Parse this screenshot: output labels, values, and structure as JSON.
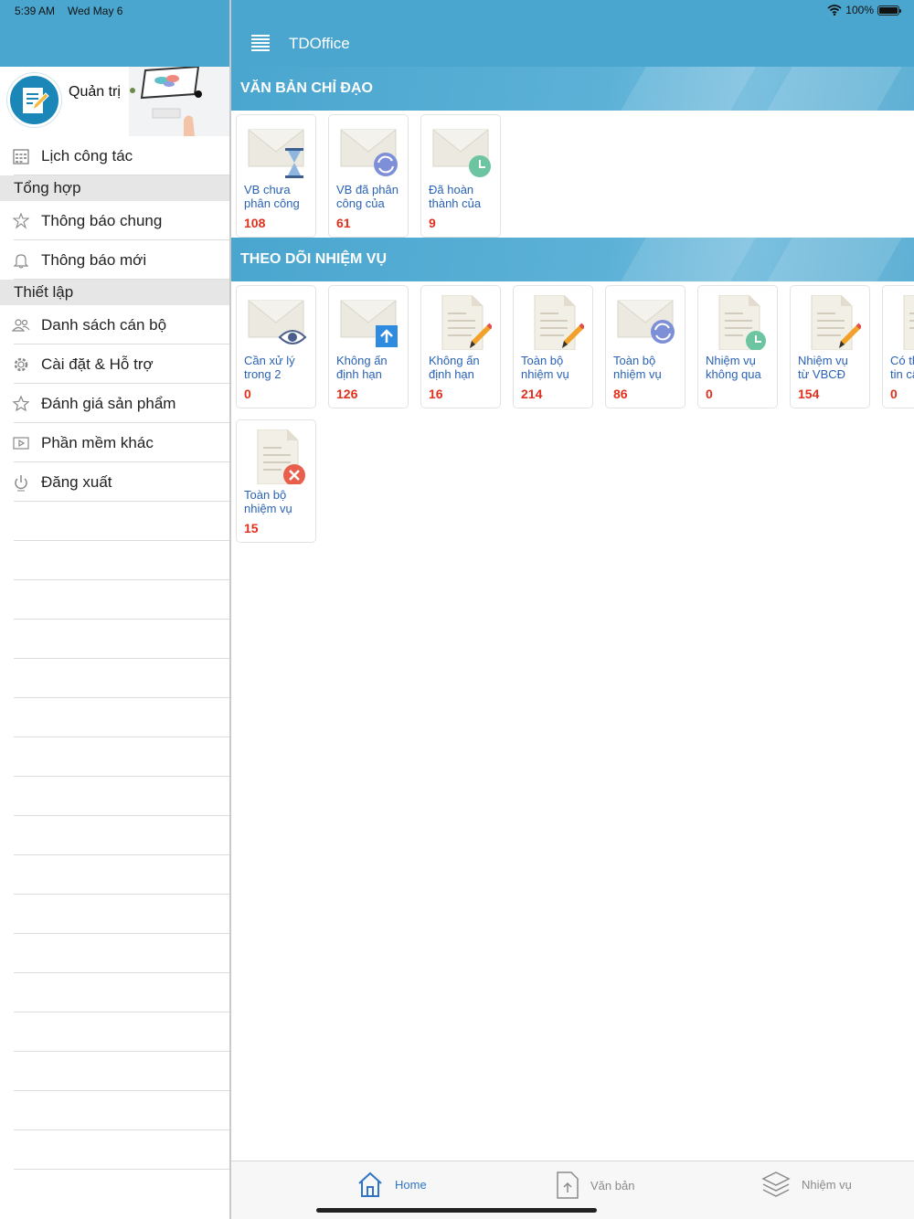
{
  "status_bar": {
    "time": "5:39 AM",
    "date": "Wed May 6",
    "battery": "100%"
  },
  "sidebar": {
    "profile_name": "Quản trị",
    "top_item": {
      "label": "Lịch công tác",
      "icon": "calendar-icon"
    },
    "groups": [
      {
        "title": "Tổng hợp",
        "items": [
          {
            "label": "Thông báo chung",
            "icon": "megaphone-icon"
          },
          {
            "label": "Thông báo mới",
            "icon": "bell-icon"
          }
        ]
      },
      {
        "title": "Thiết lập",
        "items": [
          {
            "label": "Danh sách cán bộ",
            "icon": "users-icon"
          },
          {
            "label": "Cài đặt & Hỗ trợ",
            "icon": "gear-icon"
          },
          {
            "label": "Đánh giá sản phẩm",
            "icon": "star-icon"
          },
          {
            "label": "Phần mềm khác",
            "icon": "play-box-icon"
          },
          {
            "label": "Đăng xuất",
            "icon": "power-icon"
          }
        ]
      }
    ]
  },
  "navbar": {
    "title": "TDOffice"
  },
  "sections": [
    {
      "title": "VĂN BẢN CHỈ ĐẠO",
      "tiles": [
        {
          "line1": "VB chưa",
          "line2": "phân công",
          "count": "108",
          "icon": "envelope-hourglass-icon"
        },
        {
          "line1": "VB đã phân",
          "line2": "công của",
          "count": "61",
          "icon": "envelope-sync-icon"
        },
        {
          "line1": "Đã hoàn",
          "line2": "thành của",
          "count": "9",
          "icon": "envelope-clock-icon"
        }
      ]
    },
    {
      "title": "THEO DÕI NHIỆM VỤ",
      "tiles": [
        {
          "line1": "Cần xử lý",
          "line2": "trong 2",
          "count": "0",
          "icon": "envelope-eye-icon"
        },
        {
          "line1": "Không ấn",
          "line2": "định hạn",
          "count": "126",
          "icon": "envelope-upload-icon"
        },
        {
          "line1": "Không ấn",
          "line2": "định hạn",
          "count": "16",
          "icon": "document-pencil-icon"
        },
        {
          "line1": "Toàn bộ",
          "line2": "nhiệm vụ",
          "count": "214",
          "icon": "document-pencil-icon"
        },
        {
          "line1": "Toàn bộ",
          "line2": "nhiệm vụ",
          "count": "86",
          "icon": "envelope-sync-icon"
        },
        {
          "line1": "Nhiệm vụ",
          "line2": "không qua",
          "count": "0",
          "icon": "document-clock-icon"
        },
        {
          "line1": "Nhiệm vụ",
          "line2": "từ VBCĐ",
          "count": "154",
          "icon": "document-pencil-icon"
        },
        {
          "line1": "Có th",
          "line2": "tin cậ",
          "count": "0",
          "icon": "document-icon"
        },
        {
          "line1": "Toàn bộ",
          "line2": "nhiệm vụ",
          "count": "15",
          "icon": "document-cancel-icon"
        }
      ]
    }
  ],
  "tabbar": [
    {
      "label": "Home",
      "icon": "home-icon",
      "active": true
    },
    {
      "label": "Văn bản",
      "icon": "document-upload-icon",
      "active": false
    },
    {
      "label": "Nhiệm vụ",
      "icon": "layers-icon",
      "active": false
    }
  ],
  "colors": {
    "primary": "#4aa6cf",
    "tile_label": "#2a62b5",
    "count": "#e0301e",
    "tab_active": "#2f74c6"
  }
}
